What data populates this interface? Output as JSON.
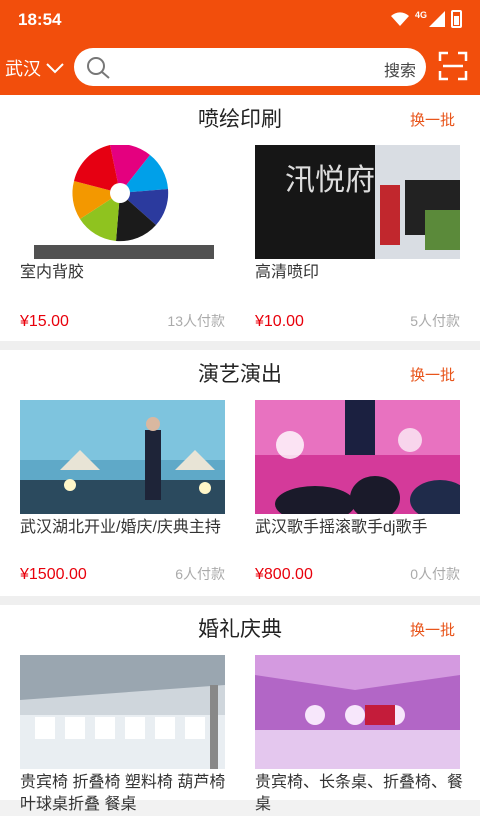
{
  "status": {
    "time": "18:54",
    "network": "4G"
  },
  "header": {
    "city": "武汉",
    "search_placeholder": "",
    "search_button": "搜索"
  },
  "sections": [
    {
      "title": "喷绘印刷",
      "more": "换一批",
      "items": [
        {
          "name": "室内背胶",
          "price": "¥15.00",
          "sold": "13人付款"
        },
        {
          "name": "高清喷印",
          "price": "¥10.00",
          "sold": "5人付款"
        }
      ]
    },
    {
      "title": "演艺演出",
      "more": "换一批",
      "items": [
        {
          "name": "武汉湖北开业/婚庆/庆典主持",
          "price": "¥1500.00",
          "sold": "6人付款"
        },
        {
          "name": "武汉歌手摇滚歌手dj歌手",
          "price": "¥800.00",
          "sold": "0人付款"
        }
      ]
    },
    {
      "title": "婚礼庆典",
      "more": "换一批",
      "items": [
        {
          "name": "贵宾椅 折叠椅 塑料椅 葫芦椅 叶球桌折叠 餐桌",
          "price": "",
          "sold": ""
        },
        {
          "name": "贵宾椅、长条桌、折叠椅、餐桌",
          "price": "",
          "sold": ""
        }
      ]
    }
  ]
}
